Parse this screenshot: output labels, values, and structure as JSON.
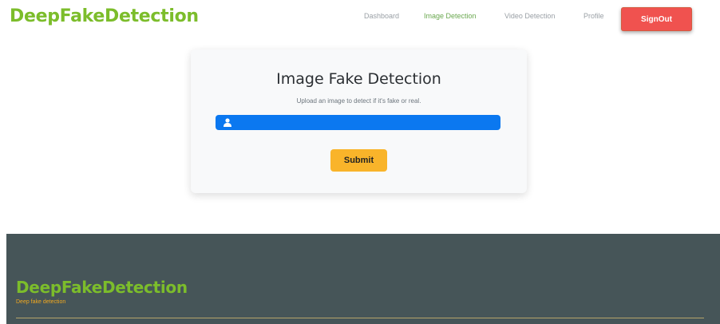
{
  "navbar": {
    "brand": "DeepFakeDetection",
    "links": [
      {
        "label": "Dashboard"
      },
      {
        "label": "Image Detection",
        "active": true
      },
      {
        "label": "Video Detection"
      },
      {
        "label": "Profile"
      }
    ],
    "signout_label": "SignOut"
  },
  "card": {
    "title": "Image Fake Detection",
    "subtitle": "Upload an image to detect if it's fake or real.",
    "file_input_icon": "user-icon",
    "submit_label": "Submit"
  },
  "footer": {
    "brand": "DeepFakeDetection",
    "tagline": "Deep fake detection"
  },
  "colors": {
    "brand_green": "#7cbd2b",
    "signout_red": "#f0524f",
    "file_input_blue": "#0b78f0",
    "submit_yellow": "#f9b42a",
    "footer_bg": "#465558",
    "tagline_orange": "#f0a820"
  }
}
